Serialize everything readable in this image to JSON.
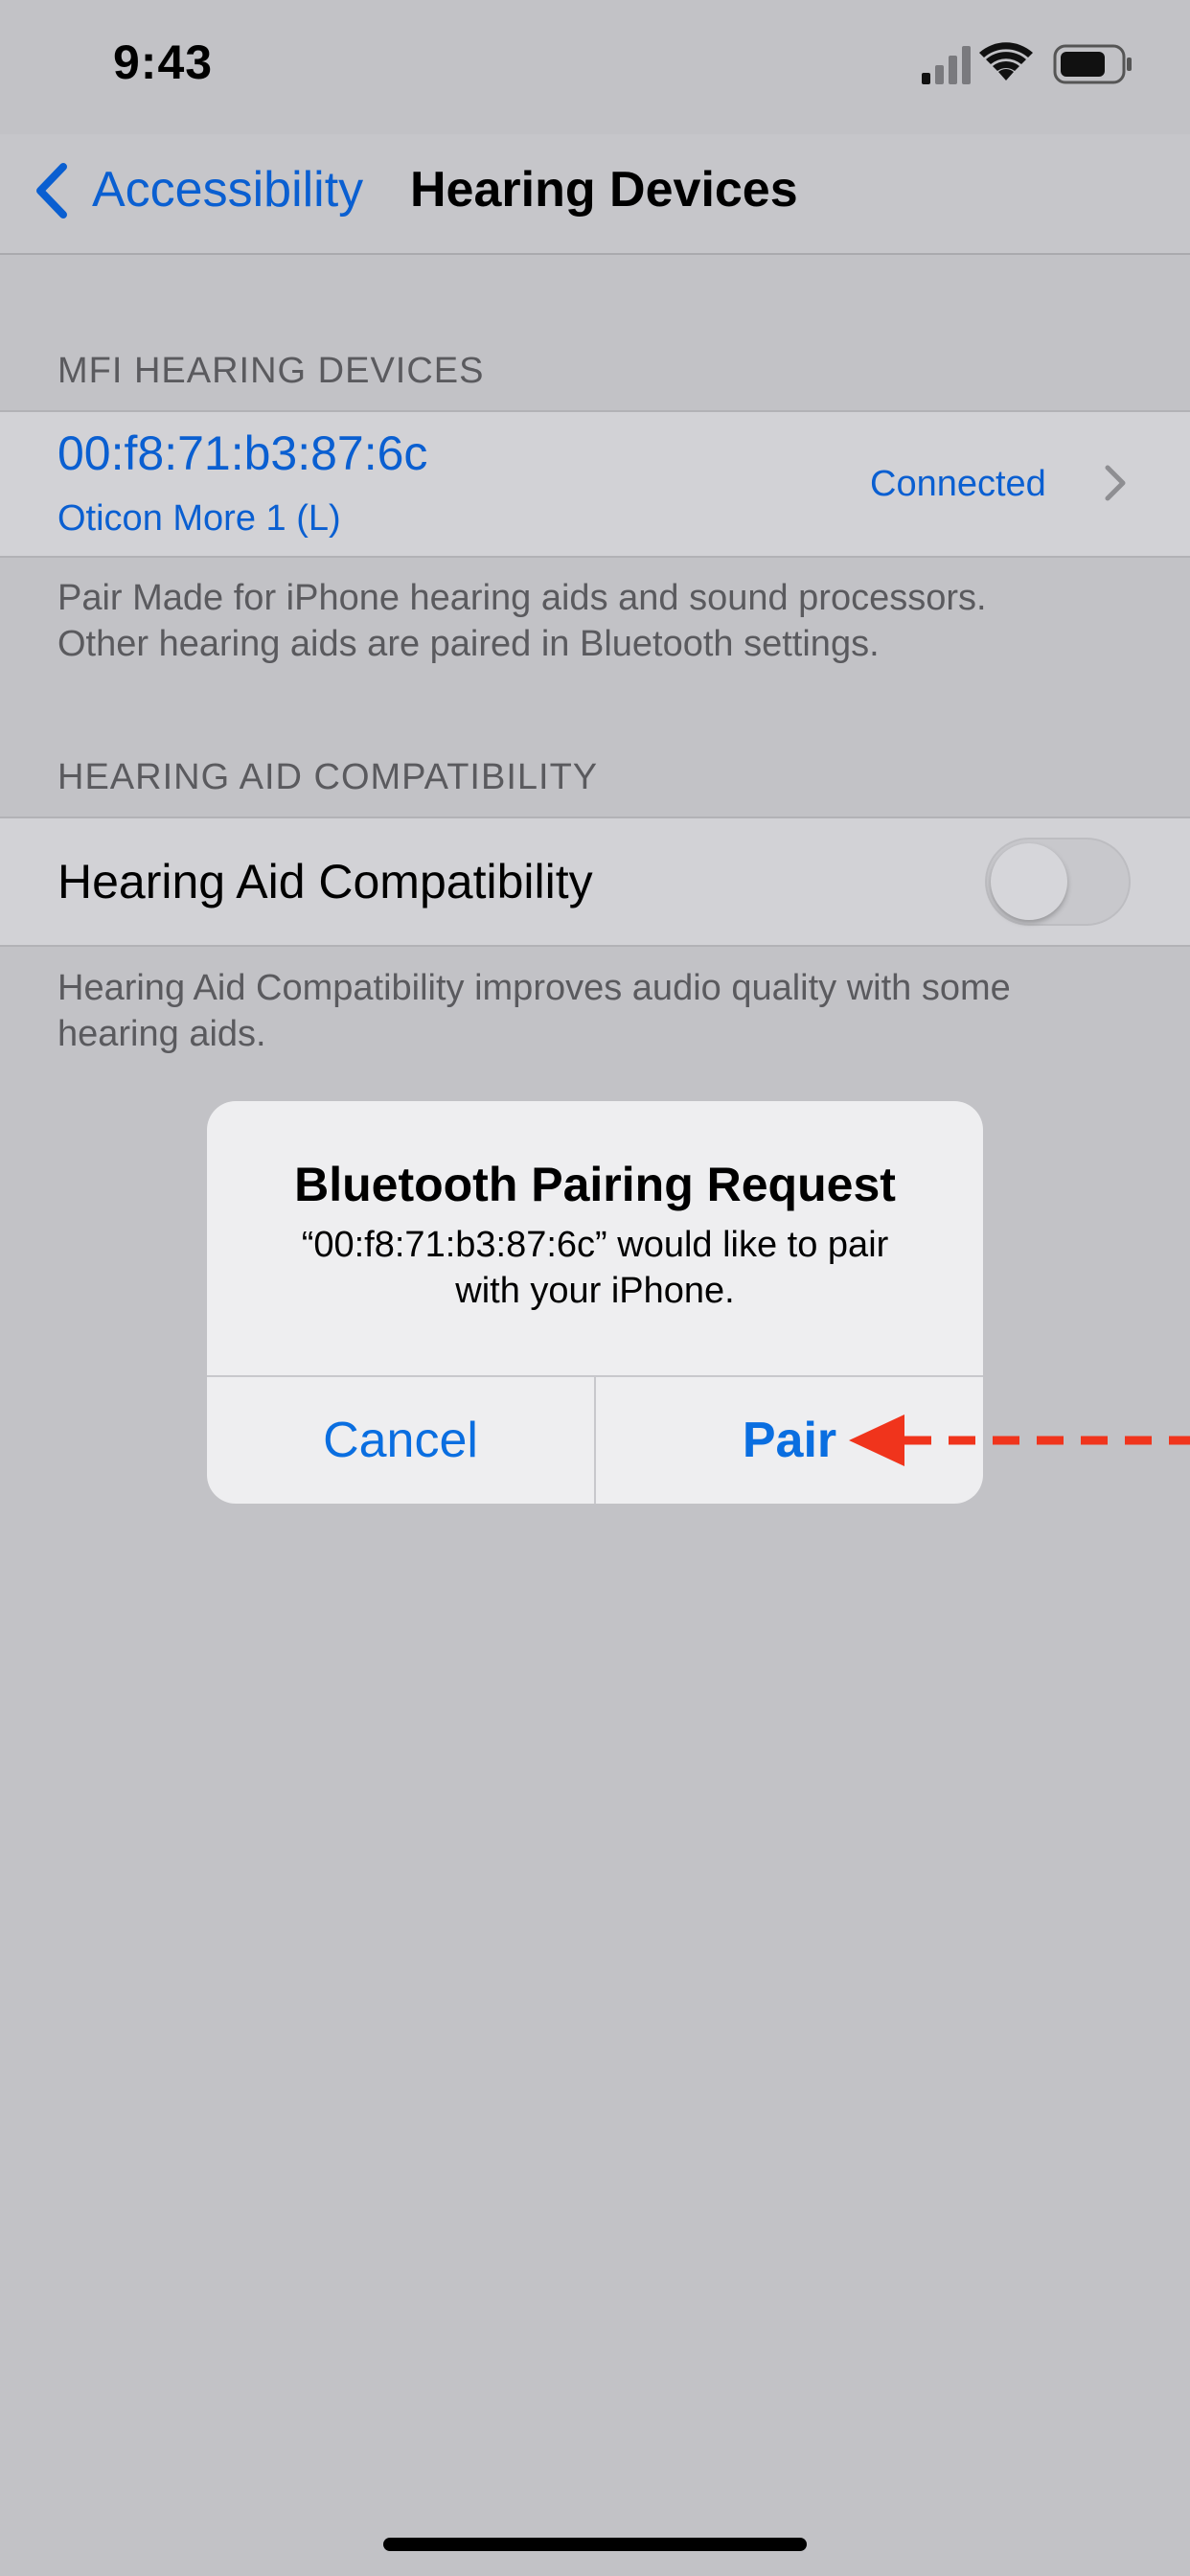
{
  "status_bar": {
    "time": "9:43",
    "icons": [
      "cellular-signal-icon",
      "wifi-icon",
      "battery-icon"
    ]
  },
  "nav": {
    "back_label": "Accessibility",
    "title": "Hearing Devices"
  },
  "mfi_section": {
    "header": "MFI HEARING DEVICES",
    "device": {
      "address": "00:f8:71:b3:87:6c",
      "name": "Oticon More 1 (L)",
      "status": "Connected"
    },
    "footer": [
      "Pair Made for iPhone hearing aids and sound processors.",
      "Other hearing aids are paired in Bluetooth settings."
    ]
  },
  "hac_section": {
    "header": "HEARING AID COMPATIBILITY",
    "row_label": "Hearing Aid Compatibility",
    "toggle_on": false,
    "footer": [
      "Hearing Aid Compatibility improves audio quality with some",
      "hearing aids."
    ]
  },
  "alert": {
    "title": "Bluetooth Pairing Request",
    "message_line1": "“00:f8:71:b3:87:6c” would like to pair",
    "message_line2": "with your iPhone.",
    "cancel_label": "Cancel",
    "pair_label": "Pair"
  },
  "colors": {
    "accent": "#0a5fd1",
    "annotation_arrow": "#f0341c"
  }
}
